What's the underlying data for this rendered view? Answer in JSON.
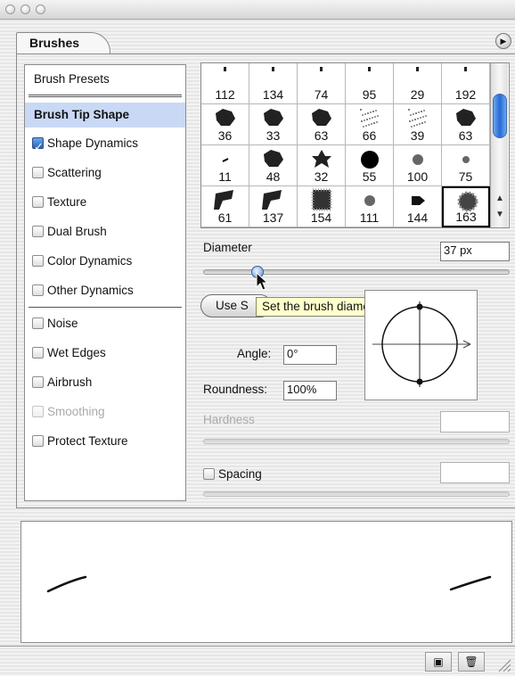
{
  "tab": {
    "title": "Brushes"
  },
  "left_panel": {
    "presets_label": "Brush Presets",
    "tip_shape_label": "Brush Tip Shape",
    "options": [
      {
        "label": "Shape Dynamics",
        "checked": true,
        "enabled": true
      },
      {
        "label": "Scattering",
        "checked": false,
        "enabled": true
      },
      {
        "label": "Texture",
        "checked": false,
        "enabled": true
      },
      {
        "label": "Dual Brush",
        "checked": false,
        "enabled": true
      },
      {
        "label": "Color Dynamics",
        "checked": false,
        "enabled": true
      },
      {
        "label": "Other Dynamics",
        "checked": false,
        "enabled": true
      },
      {
        "label": "Noise",
        "checked": false,
        "enabled": true
      },
      {
        "label": "Wet Edges",
        "checked": false,
        "enabled": true
      },
      {
        "label": "Airbrush",
        "checked": false,
        "enabled": true
      },
      {
        "label": "Smoothing",
        "checked": false,
        "enabled": false
      },
      {
        "label": "Protect Texture",
        "checked": false,
        "enabled": true
      }
    ]
  },
  "brush_grid": {
    "rows": [
      [
        "112",
        "134",
        "74",
        "95",
        "29",
        "192"
      ],
      [
        "36",
        "33",
        "63",
        "66",
        "39",
        "63"
      ],
      [
        "11",
        "48",
        "32",
        "55",
        "100",
        "75"
      ],
      [
        "61",
        "137",
        "154",
        "111",
        "144",
        "163"
      ]
    ],
    "selected": "163"
  },
  "diameter": {
    "label": "Diameter",
    "value": "37 px",
    "tooltip": "Set the brush diameter"
  },
  "use_sample_button": "Use S",
  "angle": {
    "label": "Angle:",
    "value": "0°"
  },
  "roundness": {
    "label": "Roundness:",
    "value": "100%"
  },
  "hardness": {
    "label": "Hardness"
  },
  "spacing": {
    "label": "Spacing",
    "checked": false
  },
  "colors": {
    "accent_blue": "#2a62c0",
    "tooltip_bg": "#ffffcc",
    "selection": "#c9d9f5"
  }
}
